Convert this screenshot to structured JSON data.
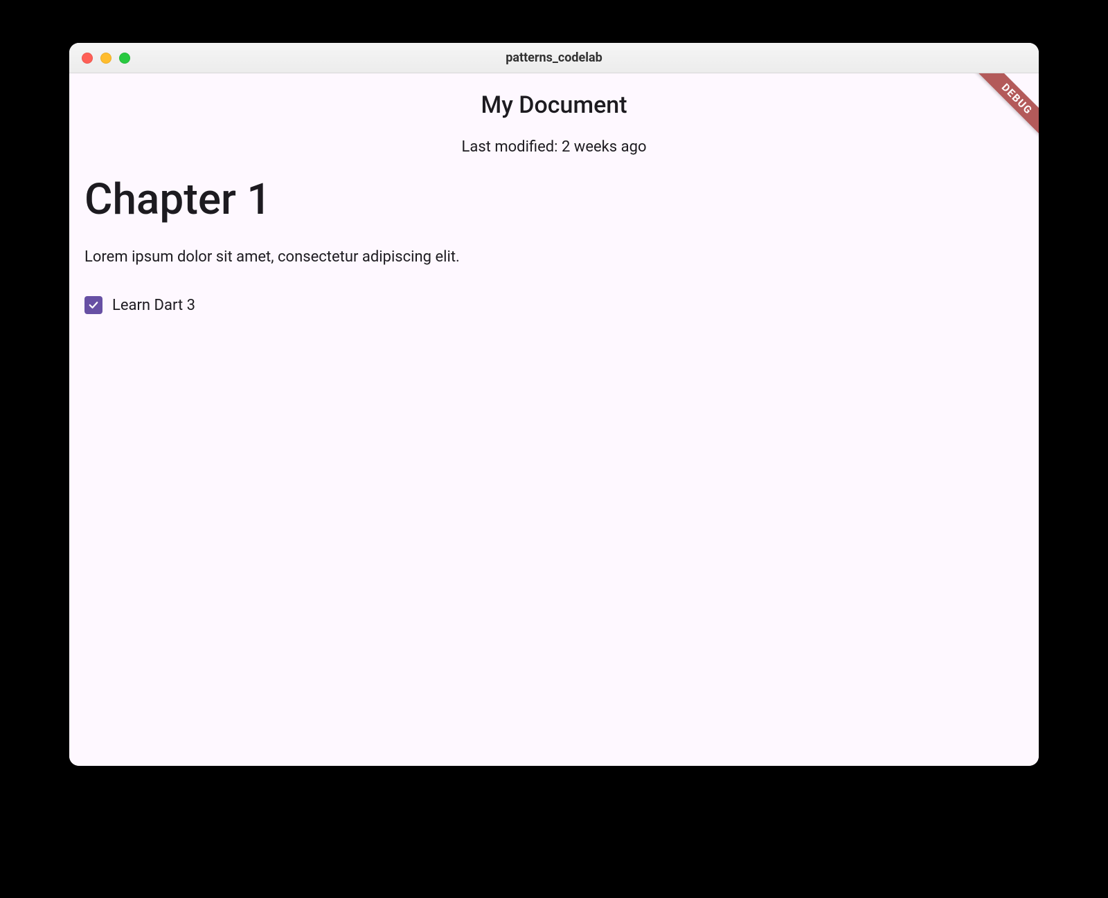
{
  "window": {
    "title": "patterns_codelab"
  },
  "debug_banner": "DEBUG",
  "document": {
    "title": "My Document",
    "subtitle": "Last modified: 2 weeks ago",
    "blocks": [
      {
        "type": "heading",
        "text": "Chapter 1"
      },
      {
        "type": "paragraph",
        "text": "Lorem ipsum dolor sit amet, consectetur adipiscing elit."
      },
      {
        "type": "checkbox",
        "checked": true,
        "label": "Learn Dart 3"
      }
    ]
  },
  "colors": {
    "primary": "#6750a4",
    "surface": "#fef8ff",
    "text": "#1d1b20"
  }
}
